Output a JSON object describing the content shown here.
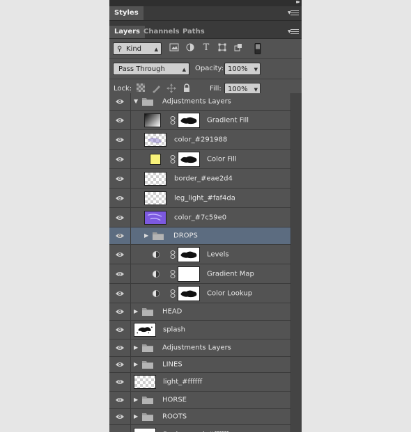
{
  "panel": {
    "styles_tab": "Styles",
    "tabs": [
      "Layers",
      "Channels",
      "Paths"
    ]
  },
  "filter": {
    "kind_label": "Kind"
  },
  "blend": {
    "mode": "Pass Through",
    "opacity_label": "Opacity:",
    "opacity_value": "100%"
  },
  "lock": {
    "label": "Lock:",
    "fill_label": "Fill:",
    "fill_value": "100%"
  },
  "colors": {
    "panel": "#535353",
    "selected_row": "#5c6c80",
    "color_fill_swatch": "#f8f27a",
    "purple_layer": "#7c59e0"
  },
  "layers": [
    {
      "name": "Adjustments Layers",
      "kind": "group-open"
    },
    {
      "name": "Gradient Fill",
      "kind": "gradient-fill"
    },
    {
      "name": "color_#291988",
      "kind": "pixel"
    },
    {
      "name": "Color Fill",
      "kind": "color-fill"
    },
    {
      "name": "border_#eae2d4",
      "kind": "pixel"
    },
    {
      "name": "leg_light_#faf4da",
      "kind": "pixel"
    },
    {
      "name": "color_#7c59e0",
      "kind": "pixel-purple"
    },
    {
      "name": "DROPS",
      "kind": "group-closed-nested"
    },
    {
      "name": "Levels",
      "kind": "adjustment"
    },
    {
      "name": "Gradient Map",
      "kind": "adjustment"
    },
    {
      "name": "Color Lookup",
      "kind": "adjustment"
    },
    {
      "name": "HEAD",
      "kind": "group"
    },
    {
      "name": "splash",
      "kind": "splash"
    },
    {
      "name": "Adjustments Layers",
      "kind": "group"
    },
    {
      "name": "LINES",
      "kind": "group"
    },
    {
      "name": "light_#ffffff",
      "kind": "pixel-top"
    },
    {
      "name": "HORSE",
      "kind": "group"
    },
    {
      "name": "ROOTS",
      "kind": "group"
    },
    {
      "name": "Background_#ffffff",
      "kind": "background"
    }
  ]
}
